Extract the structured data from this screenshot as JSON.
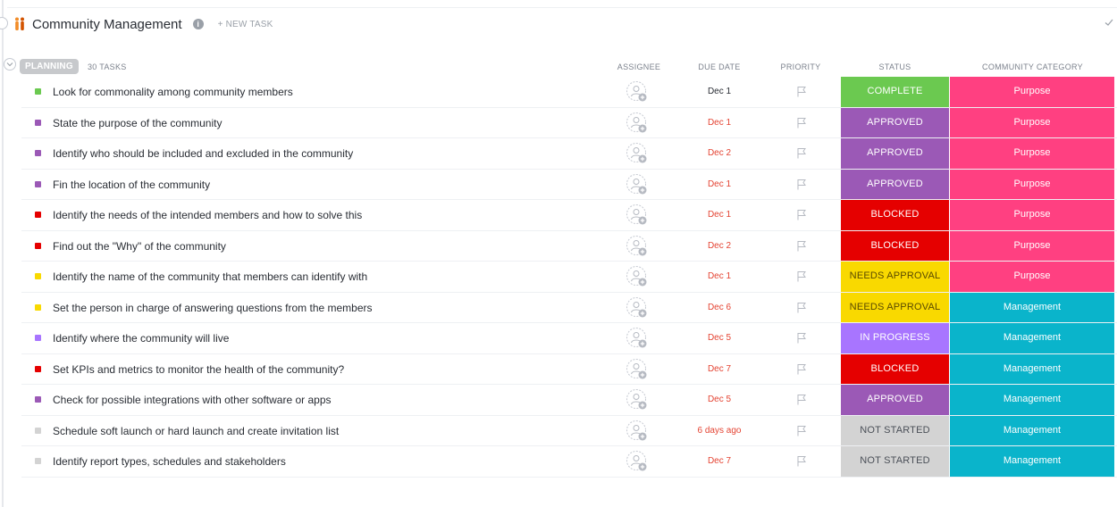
{
  "list": {
    "title": "Community Management",
    "info_icon": "info-icon",
    "info_glyph": "i",
    "new_task": "+ NEW TASK",
    "header_icon": "people-icon"
  },
  "group": {
    "label": "PLANNING",
    "count": "30 TASKS"
  },
  "columns": {
    "assignee": "ASSIGNEE",
    "due": "DUE DATE",
    "priority": "PRIORITY",
    "status": "STATUS",
    "category": "COMMUNITY CATEGORY"
  },
  "colors": {
    "complete": "#6bc950",
    "approved": "#9b59b6",
    "blocked": "#e50000",
    "needs_approval": "#f9d900",
    "in_progress": "#a875ff",
    "not_started": "#d3d3d3",
    "purpose": "#ff4081",
    "management": "#0ab4cb",
    "due_red": "#e44332",
    "due_normal": "#292d34"
  },
  "tasks": [
    {
      "name": "Look for commonality among community members",
      "due": "Dec 1",
      "due_overdue": false,
      "status": "COMPLETE",
      "status_key": "complete",
      "category": "Purpose",
      "category_key": "purpose"
    },
    {
      "name": "State the purpose of the community",
      "due": "Dec 1",
      "due_overdue": true,
      "status": "APPROVED",
      "status_key": "approved",
      "category": "Purpose",
      "category_key": "purpose"
    },
    {
      "name": "Identify who should be included and excluded in the community",
      "due": "Dec 2",
      "due_overdue": true,
      "status": "APPROVED",
      "status_key": "approved",
      "category": "Purpose",
      "category_key": "purpose"
    },
    {
      "name": "Fin the location of the community",
      "due": "Dec 1",
      "due_overdue": true,
      "status": "APPROVED",
      "status_key": "approved",
      "category": "Purpose",
      "category_key": "purpose"
    },
    {
      "name": "Identify the needs of the intended members and how to solve this",
      "due": "Dec 1",
      "due_overdue": true,
      "status": "BLOCKED",
      "status_key": "blocked",
      "category": "Purpose",
      "category_key": "purpose"
    },
    {
      "name": "Find out the \"Why\" of the community",
      "due": "Dec 2",
      "due_overdue": true,
      "status": "BLOCKED",
      "status_key": "blocked",
      "category": "Purpose",
      "category_key": "purpose"
    },
    {
      "name": "Identify the name of the community that members can identify with",
      "due": "Dec 1",
      "due_overdue": true,
      "status": "NEEDS APPROVAL",
      "status_key": "needs_approval",
      "category": "Purpose",
      "category_key": "purpose"
    },
    {
      "name": "Set the person in charge of answering questions from the members",
      "due": "Dec 6",
      "due_overdue": true,
      "status": "NEEDS APPROVAL",
      "status_key": "needs_approval",
      "category": "Management",
      "category_key": "management"
    },
    {
      "name": "Identify where the community will live",
      "due": "Dec 5",
      "due_overdue": true,
      "status": "IN PROGRESS",
      "status_key": "in_progress",
      "category": "Management",
      "category_key": "management"
    },
    {
      "name": "Set KPIs and metrics to monitor the health of the community?",
      "due": "Dec 7",
      "due_overdue": true,
      "status": "BLOCKED",
      "status_key": "blocked",
      "category": "Management",
      "category_key": "management"
    },
    {
      "name": "Check for possible integrations with other software or apps",
      "due": "Dec 5",
      "due_overdue": true,
      "status": "APPROVED",
      "status_key": "approved",
      "category": "Management",
      "category_key": "management"
    },
    {
      "name": "Schedule soft launch or hard launch and create invitation list",
      "due": "6 days ago",
      "due_overdue": true,
      "status": "NOT STARTED",
      "status_key": "not_started",
      "category": "Management",
      "category_key": "management"
    },
    {
      "name": "Identify report types, schedules and stakeholders",
      "due": "Dec 7",
      "due_overdue": true,
      "status": "NOT STARTED",
      "status_key": "not_started",
      "category": "Management",
      "category_key": "management"
    }
  ]
}
